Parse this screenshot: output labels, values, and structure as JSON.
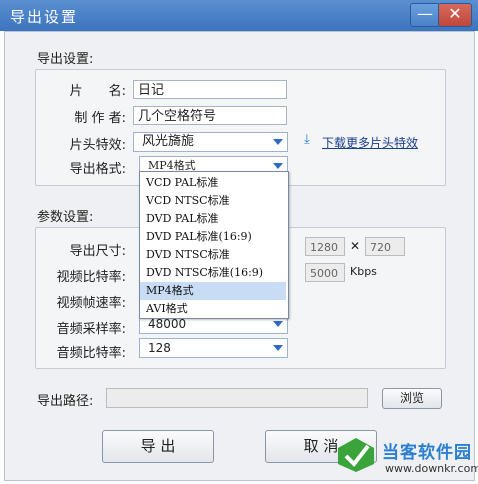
{
  "window": {
    "title": "导出设置",
    "minimize_icon": "—",
    "close_icon": "✕"
  },
  "export_section": {
    "heading": "导出设置:",
    "name_label": "片　　名:",
    "name_value": "日记",
    "author_label": "制 作 者:",
    "author_value": "几个空格符号",
    "intro_label": "片头特效:",
    "intro_value": "风光旖旎",
    "download_link": "下载更多片头特效",
    "format_label": "导出格式:",
    "format_value": "MP4格式",
    "format_options": [
      "VCD PAL标准",
      "VCD NTSC标准",
      "DVD PAL标准",
      "DVD PAL标准(16:9)",
      "DVD NTSC标准",
      "DVD NTSC标准(16:9)",
      "MP4格式",
      "AVI格式"
    ],
    "selected_option_index": 6
  },
  "param_section": {
    "heading": "参数设置:",
    "size_label": "导出尺寸:",
    "width_value": "1280",
    "times_sign": "✕",
    "height_value": "720",
    "vbitrate_label": "视频比特率:",
    "vbitrate_value": "5000",
    "vbitrate_unit": "Kbps",
    "framerate_label": "视频帧速率:",
    "samplerate_label": "音频采样率:",
    "samplerate_value": "48000",
    "abitrate_label": "音频比特率:",
    "abitrate_value": "128"
  },
  "path": {
    "label": "导出路径:",
    "value": "",
    "browse_label": "浏览"
  },
  "actions": {
    "export_label": "导 出",
    "cancel_label": "取 消"
  },
  "watermark": {
    "name": "当客软件园",
    "url": "www.downkr.com"
  },
  "colors": {
    "titlebar": "#3d74be",
    "accent": "#2e6bc4",
    "selection": "#c9dcf5",
    "close": "#c0473a"
  }
}
